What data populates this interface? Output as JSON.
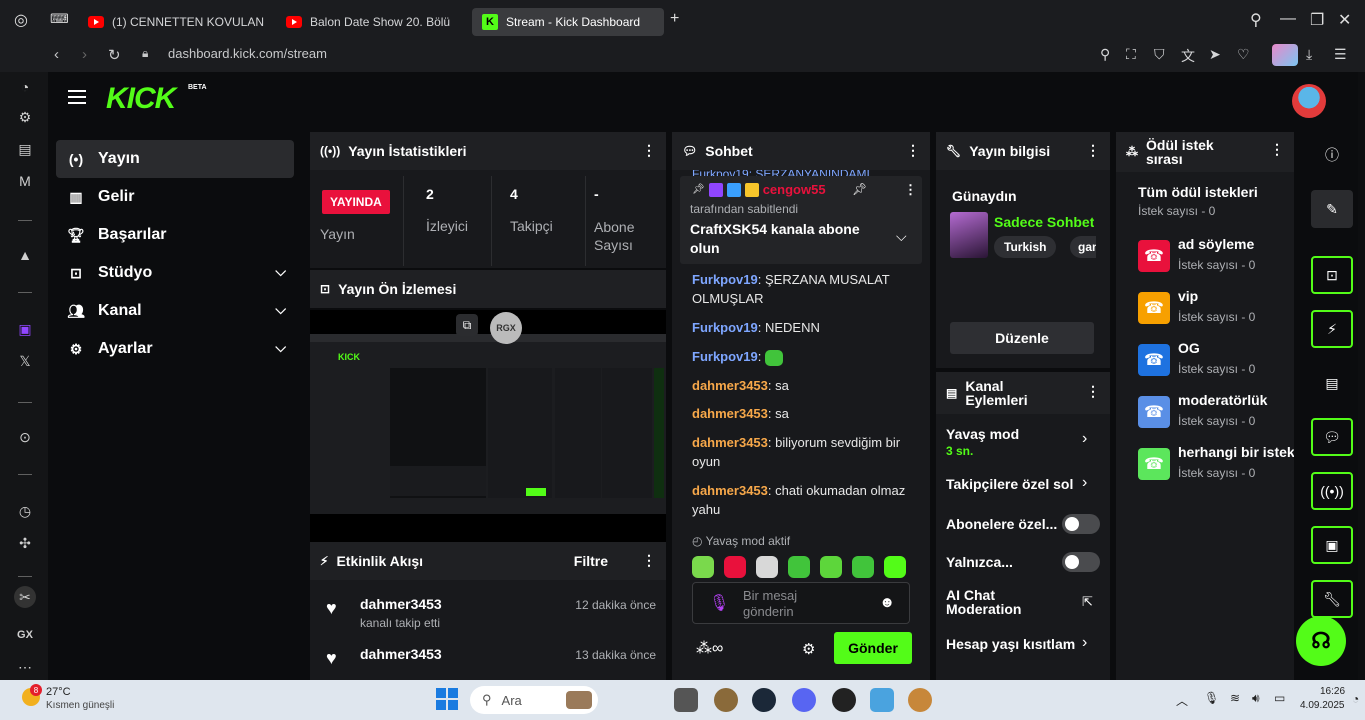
{
  "browser": {
    "tabs": [
      {
        "label": "(1) CENNETTEN KOVULAN"
      },
      {
        "label": "Balon Date Show 20. Bölü"
      },
      {
        "label": "Stream - Kick Dashboard"
      }
    ],
    "new_tab": "+",
    "url": "dashboard.kick.com/stream"
  },
  "app": {
    "logo": "KICK",
    "logo_badge": "BETA"
  },
  "nav": {
    "items": [
      {
        "label": "Yayın"
      },
      {
        "label": "Gelir"
      },
      {
        "label": "Başarılar"
      },
      {
        "label": "Stüdyo"
      },
      {
        "label": "Kanal"
      },
      {
        "label": "Ayarlar"
      }
    ]
  },
  "stats": {
    "title": "Yayın İstatistikleri",
    "live_badge": "YAYINDA",
    "live_label": "Yayın",
    "viewers": "2",
    "viewers_label": "İzleyici",
    "followers": "4",
    "followers_label": "Takipçi",
    "subs": "-",
    "subs_label": "Abone Sayısı"
  },
  "preview": {
    "title": "Yayın Ön İzlemesi"
  },
  "activity": {
    "title": "Etkinlik Akışı",
    "filter": "Filtre",
    "items": [
      {
        "user": "dahmer3453",
        "action": "kanalı takip etti",
        "time": "12 dakika önce"
      },
      {
        "user": "dahmer3453",
        "action": "",
        "time": "13 dakika önce"
      }
    ]
  },
  "chat": {
    "title": "Sohbet",
    "pinned_top": "Furkpov19: ŞERZANYANINDAMI",
    "pinned_user": "cengow55",
    "pinned_by": "tarafından sabitlendi",
    "pinned_msg": "CraftXSK54 kanala abone olun",
    "messages": [
      {
        "user": "Furkpov19",
        "text": "ŞERZANA MUSALAT OLMUŞLAR"
      },
      {
        "user": "Furkpov19",
        "text": "NEDENN"
      },
      {
        "user": "Furkpov19",
        "text": ""
      },
      {
        "user": "dahmer3453",
        "text": "sa"
      },
      {
        "user": "dahmer3453",
        "text": "sa"
      },
      {
        "user": "dahmer3453",
        "text": "biliyorum sevdiğim bir oyun"
      },
      {
        "user": "dahmer3453",
        "text": "chati okumadan olmaz yahu"
      }
    ],
    "slow_mode": "Yavaş mod aktif",
    "placeholder": "Bir mesaj gönderin",
    "send": "Gönder"
  },
  "stream_info": {
    "title": "Yayın bilgisi",
    "greeting": "Günaydın",
    "stream_title": "Sadece Sohbet",
    "tags": [
      "Turkish",
      "gam"
    ],
    "edit": "Düzenle"
  },
  "channel_actions": {
    "title": "Kanal Eylemleri",
    "slow_mode": "Yavaş mod",
    "slow_value": "3 sn.",
    "followers_only": "Takipçilere özel sol",
    "subs_only": "Abonelere özel...",
    "only": "Yalnızca...",
    "ai_chat": "AI Chat Moderation",
    "age_limit": "Hesap yaşı kısıtlam"
  },
  "rewards": {
    "title": "Ödül istek sırası",
    "all": "Tüm ödül istekleri",
    "count": "İstek sayısı - 0",
    "items": [
      {
        "name": "ad söyleme",
        "count": "İstek sayısı - 0",
        "color": "#e9113c"
      },
      {
        "name": "vip",
        "count": "İstek sayısı - 0",
        "color": "#f7a000"
      },
      {
        "name": "OG",
        "count": "İstek sayısı - 0",
        "color": "#1e72e0"
      },
      {
        "name": "moderatörlük",
        "count": "İstek sayısı - 0",
        "color": "#5a8fe6"
      },
      {
        "name": "herhangi bir istek",
        "count": "İstek sayısı - 0",
        "color": "#5ce65c"
      }
    ]
  },
  "taskbar": {
    "temp": "27°C",
    "weather": "Kısmen güneşli",
    "weather_badge": "8",
    "search": "Ara",
    "time": "16:26",
    "date": "4.09.2025"
  },
  "colors": {
    "accent": "#53fc18",
    "live": "#e9113c"
  }
}
